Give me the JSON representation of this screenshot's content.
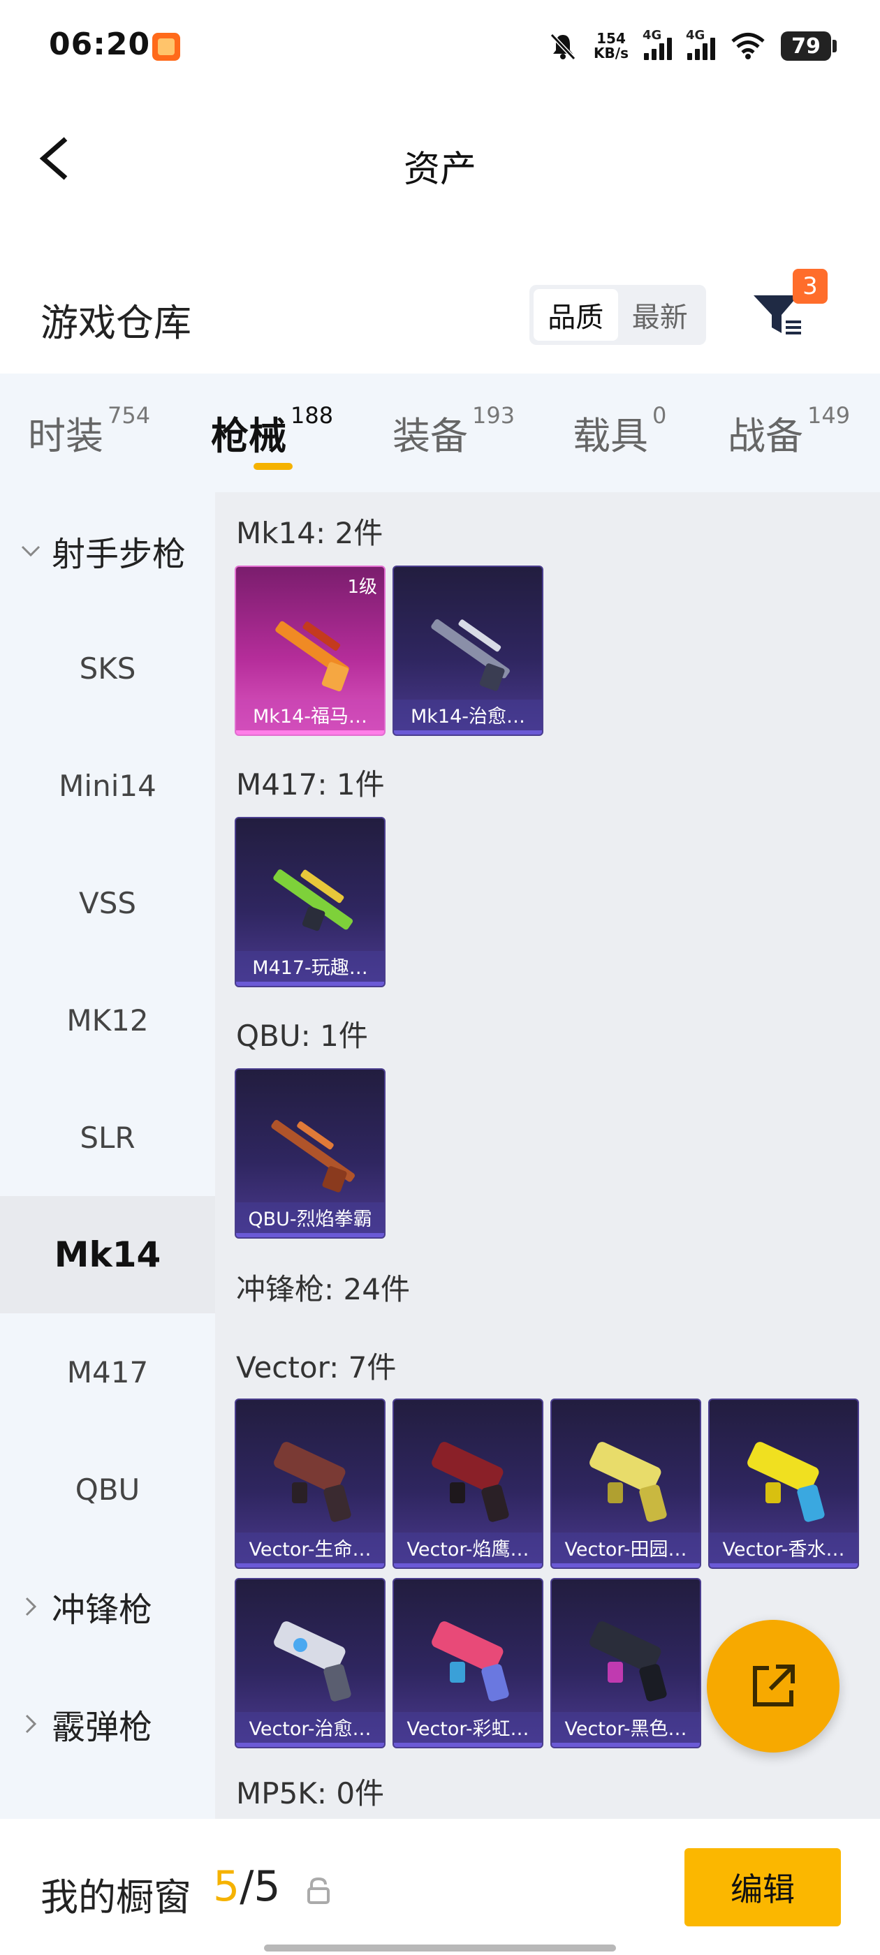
{
  "status": {
    "time": "06:20",
    "net_speed_value": "154",
    "net_speed_unit": "KB/s",
    "signal1": "4G",
    "signal2": "4G",
    "battery": "79"
  },
  "header": {
    "title": "资产"
  },
  "warehouse": {
    "title": "游戏仓库",
    "sort_options": [
      "品质",
      "最新"
    ],
    "filter_badge": "3"
  },
  "tabs": [
    {
      "label": "时装",
      "count": "754"
    },
    {
      "label": "枪械",
      "count": "188"
    },
    {
      "label": "装备",
      "count": "193"
    },
    {
      "label": "载具",
      "count": "0"
    },
    {
      "label": "战备",
      "count": "149"
    }
  ],
  "leftnav": [
    {
      "label": "射手步枪",
      "type": "group",
      "expanded": true
    },
    {
      "label": "SKS"
    },
    {
      "label": "Mini14"
    },
    {
      "label": "VSS"
    },
    {
      "label": "MK12"
    },
    {
      "label": "SLR"
    },
    {
      "label": "Mk14",
      "active": true
    },
    {
      "label": "M417"
    },
    {
      "label": "QBU"
    },
    {
      "label": "冲锋枪",
      "type": "group",
      "expanded": false
    },
    {
      "label": "霰弹枪",
      "type": "group",
      "expanded": false
    }
  ],
  "sections": {
    "mk14": {
      "title": "Mk14: 2件"
    },
    "m417": {
      "title": "M417: 1件"
    },
    "qbu": {
      "title": "QBU: 1件"
    },
    "smg": {
      "title": "冲锋枪: 24件"
    },
    "vector": {
      "title": "Vector: 7件"
    },
    "mp5k": {
      "title": "MP5K: 0件"
    }
  },
  "cards": {
    "mk14_1": {
      "name": "Mk14-福马…",
      "level": "1级"
    },
    "mk14_2": {
      "name": "Mk14-治愈…"
    },
    "m417_1": {
      "name": "M417-玩趣…"
    },
    "qbu_1": {
      "name": "QBU-烈焰拳霸"
    },
    "vec_1": {
      "name": "Vector-生命…"
    },
    "vec_2": {
      "name": "Vector-焰鹰…"
    },
    "vec_3": {
      "name": "Vector-田园…"
    },
    "vec_4": {
      "name": "Vector-香水…"
    },
    "vec_5": {
      "name": "Vector-治愈…"
    },
    "vec_6": {
      "name": "Vector-彩虹…"
    },
    "vec_7": {
      "name": "Vector-黑色…"
    }
  },
  "bottom": {
    "showcase_label": "我的橱窗",
    "showcase_current": "5",
    "showcase_total": "/5",
    "edit_label": "编辑"
  },
  "colors": {
    "accent": "#f5b200",
    "badge": "#ff6d2b"
  },
  "icons": [
    "back-arrow-icon",
    "filter-icon",
    "chevron-down-icon",
    "chevron-right-icon",
    "share-icon",
    "lock-icon",
    "wifi-icon",
    "mute-icon"
  ]
}
